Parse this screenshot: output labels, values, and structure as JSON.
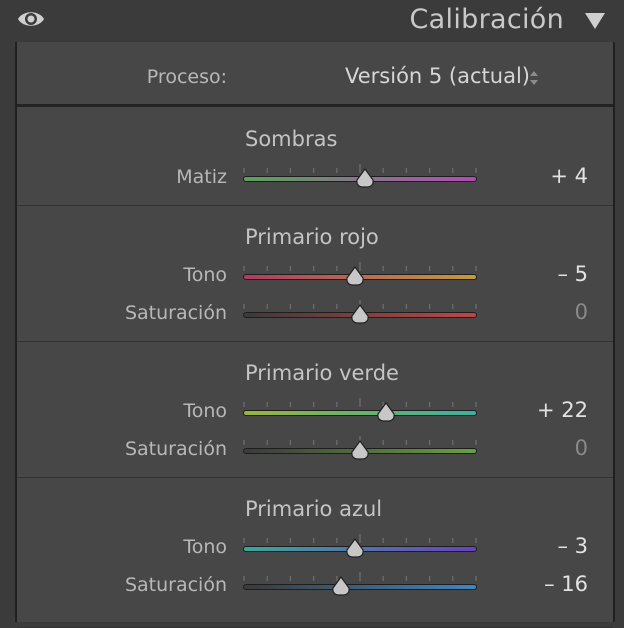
{
  "header": {
    "title": "Calibración"
  },
  "process": {
    "label": "Proceso:",
    "value": "Versión 5 (actual)"
  },
  "sections": [
    {
      "title": "Sombras",
      "rows": [
        {
          "label": "Matiz",
          "value": "+ 4",
          "level": 0.52,
          "gradient": [
            "#5aa35a",
            "#b24ab8"
          ]
        }
      ]
    },
    {
      "title": "Primario rojo",
      "rows": [
        {
          "label": "Tono",
          "value": "– 5",
          "level": 0.48,
          "gradient": [
            "#b03a64",
            "#c49a3a"
          ]
        },
        {
          "label": "Saturación",
          "value": "0",
          "level": 0.5,
          "gradient": [
            "#3a3a3a",
            "#c24545"
          ]
        }
      ]
    },
    {
      "title": "Primario verde",
      "rows": [
        {
          "label": "Tono",
          "value": "+ 22",
          "level": 0.61,
          "gradient": [
            "#9ab43a",
            "#3ab0a0"
          ]
        },
        {
          "label": "Saturación",
          "value": "0",
          "level": 0.5,
          "gradient": [
            "#3a3a3a",
            "#6aa040"
          ]
        }
      ]
    },
    {
      "title": "Primario azul",
      "rows": [
        {
          "label": "Tono",
          "value": "– 3",
          "level": 0.48,
          "gradient": [
            "#3aa89a",
            "#6a40c0"
          ]
        },
        {
          "label": "Saturación",
          "value": "– 16",
          "level": 0.42,
          "gradient": [
            "#3a3a3a",
            "#3f86c0"
          ]
        }
      ]
    }
  ],
  "icons": {
    "visibility": "eye-icon",
    "collapse": "triangle-down-icon",
    "stepper": "updown-icon"
  }
}
